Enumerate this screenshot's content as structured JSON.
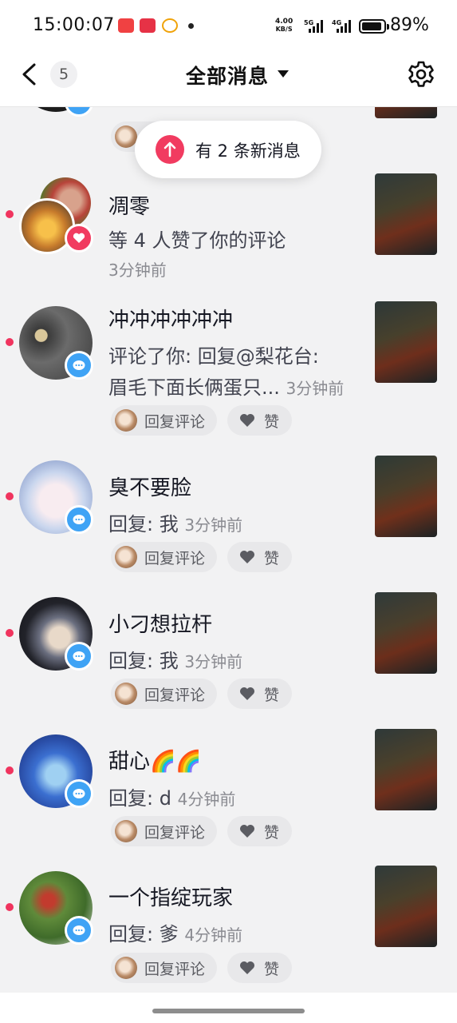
{
  "status_bar": {
    "time": "15:00:07",
    "net_speed_value": "4.00",
    "net_speed_unit": "KB/S",
    "battery": "89%"
  },
  "nav": {
    "unread_count": "5",
    "title": "全部消息"
  },
  "toast": {
    "text": "有 2 条新消息"
  },
  "reply_label": "回复评论",
  "like_label": "赞",
  "messages": [
    {
      "name": "",
      "content": "",
      "time": "",
      "badge": "comment"
    },
    {
      "name": "凋零",
      "content": "等 4 人赞了你的评论",
      "time": "3分钟前",
      "badge": "like"
    },
    {
      "name": "冲冲冲冲冲冲",
      "content": "评论了你: 回复@梨花台:",
      "content2": "眉毛下面长俩蛋只...",
      "time": "3分钟前",
      "badge": "comment"
    },
    {
      "name": "臭不要脸",
      "content": "回复: 我",
      "time": "3分钟前",
      "badge": "comment"
    },
    {
      "name": "小刁想拉杆",
      "content": "回复: 我",
      "time": "3分钟前",
      "badge": "comment"
    },
    {
      "name": "甜心🌈🌈",
      "content": "回复: d",
      "time": "4分钟前",
      "badge": "comment"
    },
    {
      "name": "一个指绽玩家",
      "content": "回复: 爹",
      "time": "4分钟前",
      "badge": "comment"
    }
  ]
}
